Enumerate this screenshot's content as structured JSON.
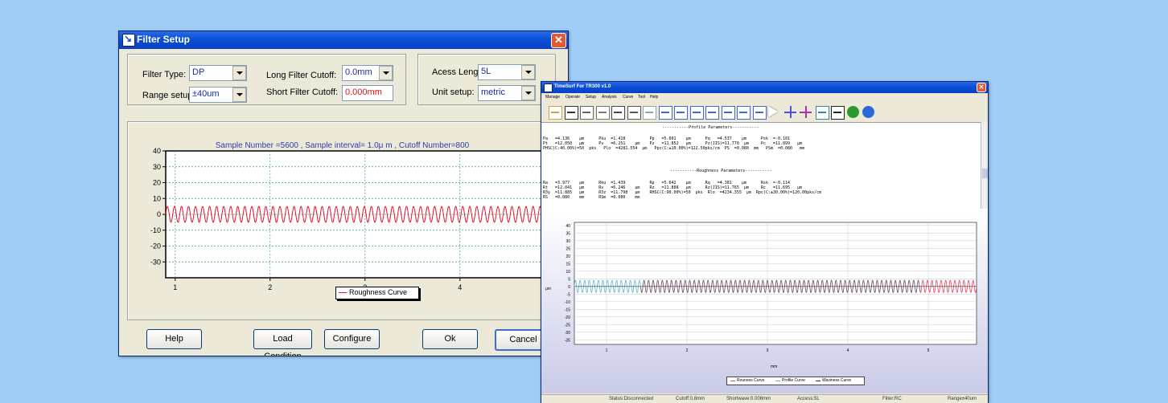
{
  "filter_dialog": {
    "title": "Filter Setup",
    "filter_type_label": "Filter Type:",
    "filter_type_value": "DP",
    "range_setup_label": "Range setup:",
    "range_setup_value": "±40um",
    "long_cutoff_label": "Long Filter Cutoff:",
    "long_cutoff_value": "0.0mm",
    "short_cutoff_label": "Short Filter Cutoff:",
    "short_cutoff_value": "0.000mm",
    "access_length_label": "Acess Length:",
    "access_length_value": "5L",
    "unit_setup_label": "Unit setup:",
    "unit_setup_value": "metric",
    "chart_info": "Sample Number =5600 , Sample interval=    1.0μ m , Cutoff Number=800",
    "legend_label": "Roughness Curve",
    "buttons": {
      "help": "Help",
      "load": "Load Condition",
      "configure": "Configure",
      "ok": "Ok",
      "cancel": "Cancel"
    }
  },
  "timesurf": {
    "title": "TimeSurf For TR300 v1.0",
    "menu": [
      "Manage",
      "Operate",
      "Setup",
      "Analysis",
      "Curve",
      "Tool",
      "Help"
    ],
    "toolbar_icons": [
      "open-icon",
      "save-icon",
      "copy-icon",
      "print-icon",
      "print-preview-icon",
      "zoom-icon",
      "profile-icon",
      "roughness-icon",
      "raw-icon",
      "waviness-icon",
      "curve-icon",
      "curve2-icon",
      "curve3-icon",
      "export-icon",
      "play-icon",
      "cross-icon",
      "measure-icon",
      "search-icon",
      "monitor-icon",
      "help-icon",
      "globe-icon"
    ],
    "profile_header": "-----------Profile Parameters-----------",
    "profile_rows": [
      "Pa   =4.136    μm      Pku  =1.418          Pp   =5.601    μm      Pq   =4.537    μm      Psk  =-0.101",
      "Pt   =12.050   μm      Pv   =6.251    μm    Pz   =11.852   μm      Pz(JIS)=11.770  μm     Pc   =11.899   μm",
      "PHSC(C:40.00%)=50  pks   Plo  =4281.554  μm   Ppc(C:±10.00%)=122.50pks/cm  PS  =0.080  mm   PSm  =0.080   mm"
    ],
    "rough_header": "-----------Roughness Parameters-----------",
    "rough_rows": [
      "Ra   =3.977    μm      Rku  =1.439          Rp   =5.642    μm      Rq   =4.381    μm      Rsk  =-0.114",
      "Rt   =12.041   μm      Rv   =6.246    μm    Rz   =11.888   μm      Rz(JIS)=11.765  μm     Rc   =11.695   μm",
      "R3y  =11.885   μm      R3z  =11.798   μm    RHSC(C:90.00%)=50  pks  Rlo  =4234.355  μm  Rpc(C:±30.00%)=120.00pks/cm",
      "RS   =0.080    mm      RSm  =0.080    mm"
    ],
    "legend": [
      "Rouness Curve",
      "Profile Curve",
      "Waviness Curve"
    ],
    "xunit": "mm",
    "yunit": "μm",
    "status": [
      "Status:Disconnected",
      "Cutoff:0.8mm",
      "Shortwave:0.008mm",
      "Access:5L",
      "Filter:RC",
      "Range±40um"
    ]
  },
  "chart_data": [
    {
      "type": "line",
      "title": "Sample Number =5600 , Sample interval=    1.0μ m , Cutoff Number=800",
      "x_ticks": [
        1,
        2,
        3,
        4
      ],
      "y_ticks": [
        40,
        30,
        20,
        10,
        0,
        -10,
        -20,
        -30
      ],
      "xlim": [
        0.9,
        4.9
      ],
      "ylim": [
        -40,
        40
      ],
      "grid": true,
      "series": [
        {
          "name": "Roughness Curve",
          "color": "#e8142a",
          "amplitude": 5,
          "cycles": 54
        }
      ]
    },
    {
      "type": "line",
      "x_ticks": [
        1,
        2,
        3,
        4,
        5
      ],
      "y_ticks": [
        40,
        35,
        30,
        25,
        20,
        15,
        10,
        5,
        0,
        -5,
        -10,
        -15,
        -20,
        -25,
        -30,
        -35
      ],
      "xlim": [
        0.6,
        5.6
      ],
      "ylim": [
        -38,
        42
      ],
      "xlabel": "mm",
      "ylabel": "μm",
      "grid": true,
      "series": [
        {
          "name": "Rouness Curve",
          "color": "#e8425a",
          "amplitude": 4,
          "cycles": 88
        },
        {
          "name": "Profile Curve",
          "color": "#5bb7c8",
          "amplitude": 4,
          "cycles": 88
        },
        {
          "name": "Waviness Curve",
          "color": "#333333",
          "amplitude": 0
        }
      ]
    }
  ]
}
